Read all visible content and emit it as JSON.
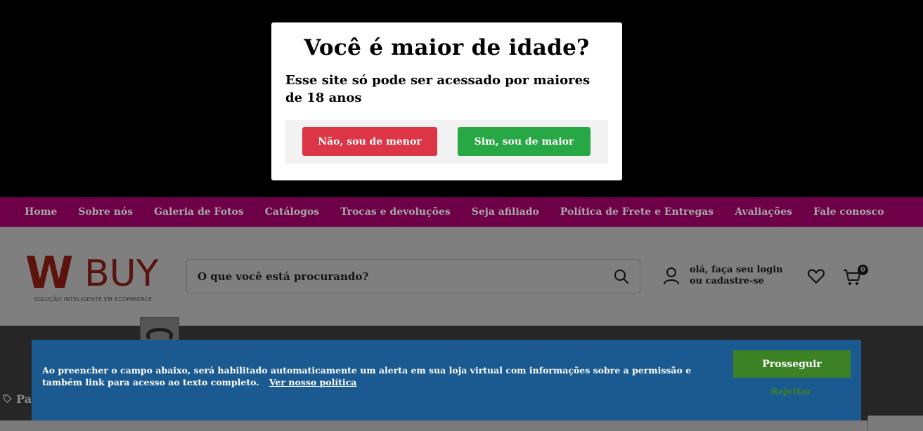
{
  "age_modal": {
    "title": "Você é maior de idade?",
    "message": "Esse site só pode ser acessado por maiores de 18 anos",
    "no_label": "Não, sou de menor",
    "yes_label": "Sim, sou de maior"
  },
  "nav": {
    "items": [
      {
        "label": "Home"
      },
      {
        "label": "Sobre nós"
      },
      {
        "label": "Galeria de Fotos"
      },
      {
        "label": "Catálogos"
      },
      {
        "label": "Trocas e devoluções"
      },
      {
        "label": "Seja afiliado"
      },
      {
        "label": "Política de Frete e Entregas"
      },
      {
        "label": "Avaliações"
      },
      {
        "label": "Fale conosco"
      }
    ]
  },
  "header": {
    "logo_main": "W",
    "logo_suffix": "BUY",
    "logo_tagline": "SOLUÇÃO INTELIGENTE EM ECOMMERCE",
    "search_placeholder": "O que você está procurando?",
    "account_text": "olá, faça seu login ou cadastre-se",
    "cart_count": "0"
  },
  "side_tag": {
    "label": "Pa"
  },
  "cookie_banner": {
    "text": "Ao preencher o campo abaixo, será habilitado automaticamente um alerta em sua loja virtual com informações sobre a permissão e também link para acesso ao texto completo.",
    "link_label": "Ver nosso política",
    "proceed_label": "Prosseguir",
    "reject_label": "Rejeitar"
  },
  "colors": {
    "nav_bg": "#6e0047",
    "btn_no": "#dc3545",
    "btn_yes": "#28a745",
    "cookie_bg": "#1b5a91",
    "proceed_bg": "#3c8123"
  },
  "icons": [
    "search-icon",
    "user-icon",
    "heart-icon",
    "cart-icon",
    "tag-icon"
  ]
}
